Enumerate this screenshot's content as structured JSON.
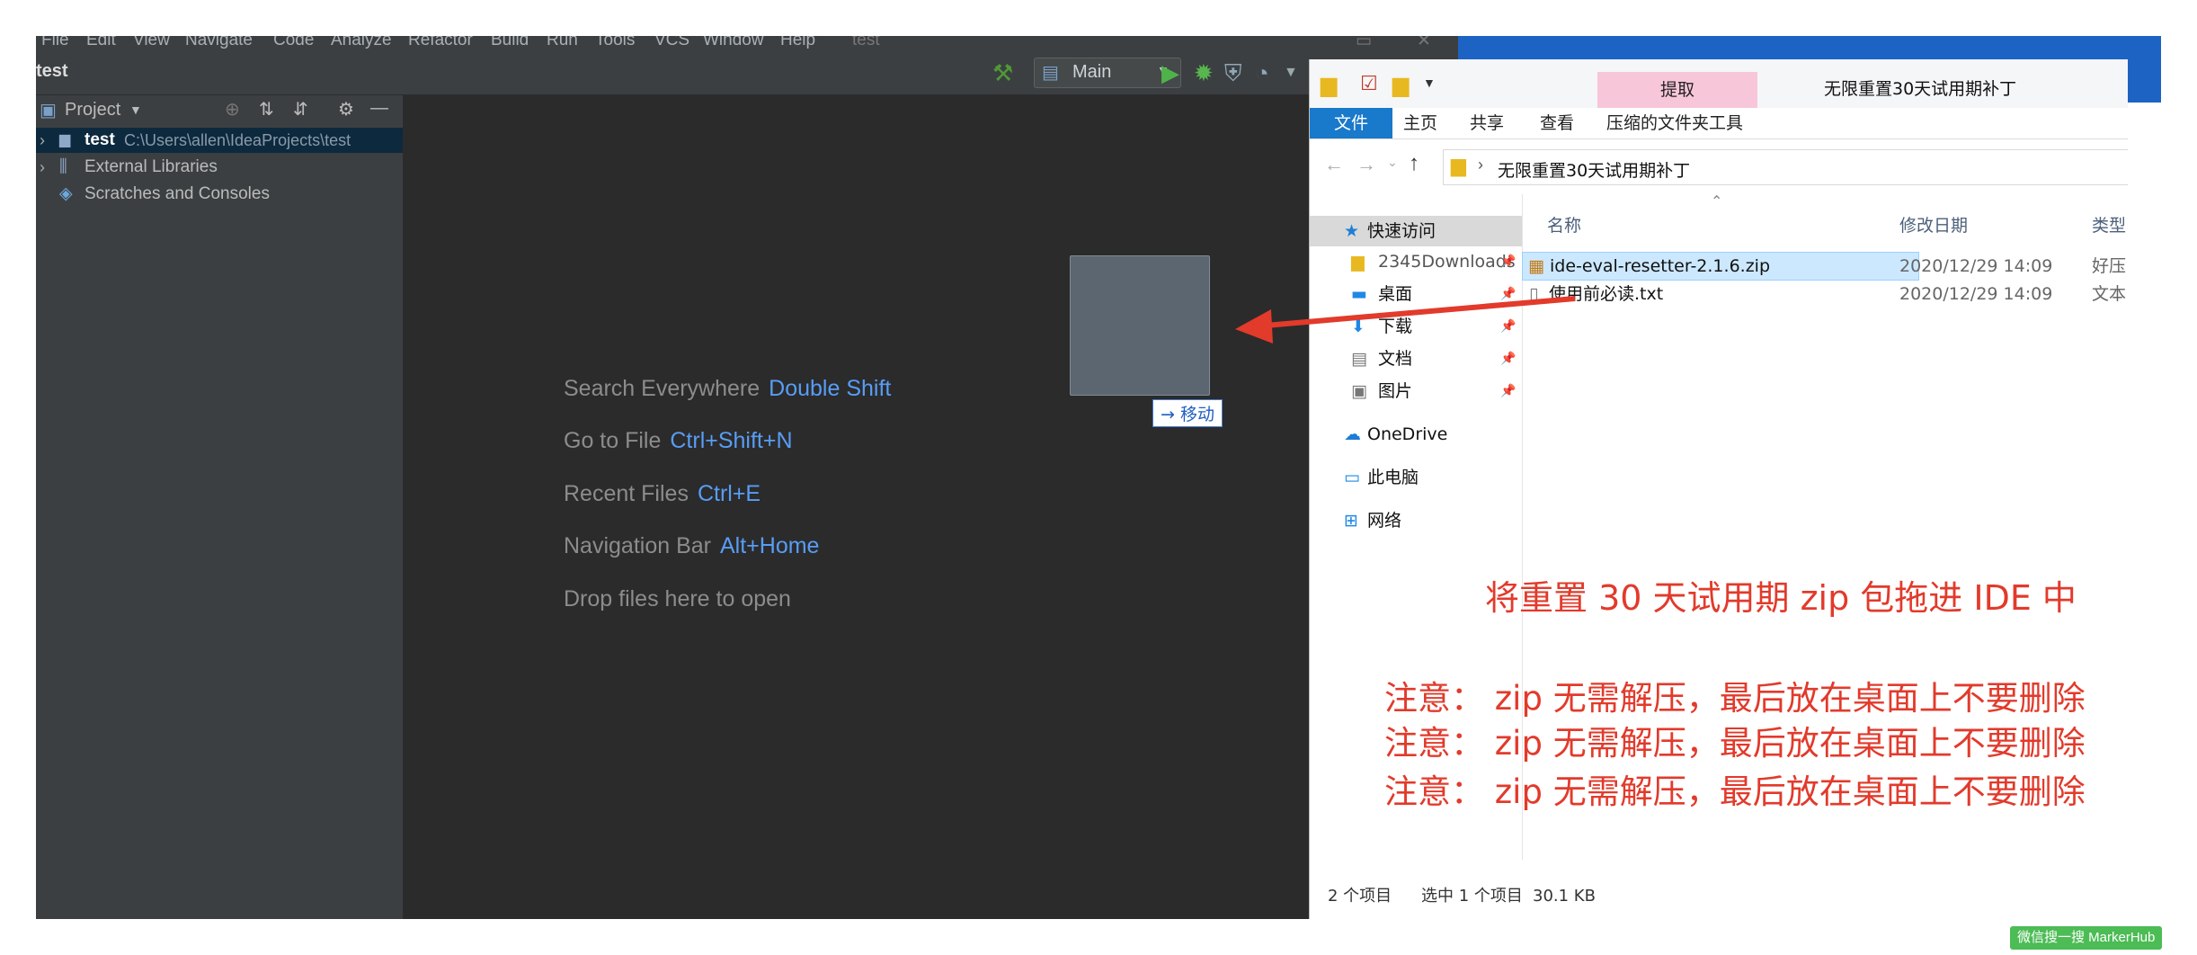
{
  "ide": {
    "menu": [
      "File",
      "Edit",
      "View",
      "Navigate",
      "Code",
      "Analyze",
      "Refactor",
      "Build",
      "Run",
      "Tools",
      "VCS",
      "Window",
      "Help",
      "test"
    ],
    "title": "test",
    "run_config": "Main",
    "project_panel": {
      "title": "Project",
      "tree": [
        {
          "name": "test",
          "path": "C:\\Users\\allen\\IdeaProjects\\test"
        },
        {
          "name": "External Libraries"
        },
        {
          "name": "Scratches and Consoles"
        }
      ]
    },
    "welcome_hints": [
      {
        "label": "Search Everywhere",
        "key": "Double Shift"
      },
      {
        "label": "Go to File",
        "key": "Ctrl+Shift+N"
      },
      {
        "label": "Recent Files",
        "key": "Ctrl+E"
      },
      {
        "label": "Navigation Bar",
        "key": "Alt+Home"
      },
      {
        "label": "Drop files here to open",
        "key": ""
      }
    ],
    "drag_tooltip": "→ 移动"
  },
  "explorer": {
    "window_title": "无限重置30天试用期补丁",
    "extract_tab": "提取",
    "tabs": [
      "文件",
      "主页",
      "共享",
      "查看",
      "压缩的文件夹工具"
    ],
    "address": "无限重置30天试用期补丁",
    "nav": [
      {
        "label": "快速访问",
        "icon": "star-icon",
        "selected": true
      },
      {
        "label": "2345Downloads",
        "icon": "folder-icon"
      },
      {
        "label": "桌面",
        "icon": "desktop-icon"
      },
      {
        "label": "下载",
        "icon": "download-icon"
      },
      {
        "label": "文档",
        "icon": "document-icon"
      },
      {
        "label": "图片",
        "icon": "picture-icon"
      },
      {
        "label": "OneDrive",
        "icon": "cloud-icon"
      },
      {
        "label": "此电脑",
        "icon": "computer-icon"
      },
      {
        "label": "网络",
        "icon": "network-icon"
      }
    ],
    "columns": [
      "名称",
      "修改日期",
      "类型"
    ],
    "files": [
      {
        "name": "ide-eval-resetter-2.1.6.zip",
        "date": "2020/12/29 14:09",
        "type": "好压",
        "selected": true
      },
      {
        "name": "使用前必读.txt",
        "date": "2020/12/29 14:09",
        "type": "文本"
      }
    ],
    "status": {
      "count": "2 个项目",
      "selected": "选中 1 个项目",
      "size": "30.1 KB"
    }
  },
  "annotations": {
    "main": "将重置 30 天试用期 zip 包拖进 IDE 中",
    "notes": [
      "注意： zip 无需解压，最后放在桌面上不要删除",
      "注意： zip 无需解压，最后放在桌面上不要删除",
      "注意： zip 无需解压，最后放在桌面上不要删除"
    ]
  },
  "watermark": "微信搜一搜 MarkerHub",
  "colors": {
    "accent": "#589df6",
    "annotation": "#e23a2b",
    "selection": "#cce8ff",
    "ide_bg": "#2b2b2b"
  }
}
